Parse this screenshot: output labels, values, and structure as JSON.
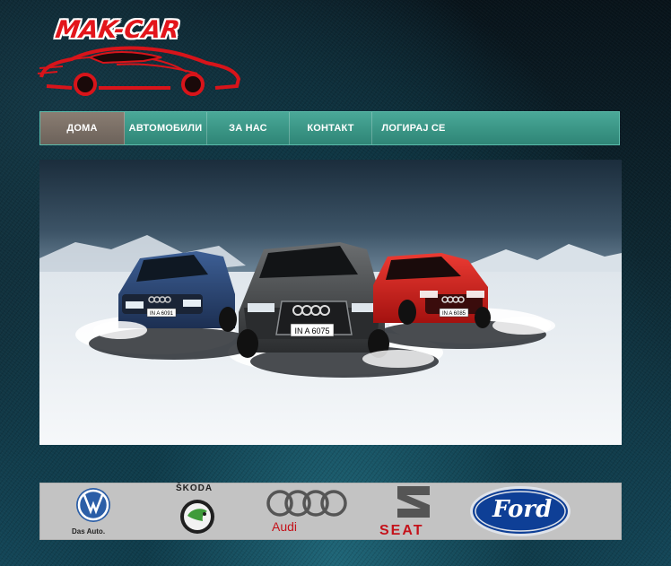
{
  "logo": {
    "text": "MAK-CAR",
    "color": "#e3151b"
  },
  "nav": {
    "items": [
      {
        "label": "ДОМА",
        "active": true
      },
      {
        "label": "АВТОМОБИЛИ"
      },
      {
        "label": "ЗА НАС"
      },
      {
        "label": "КОНТАКТ"
      },
      {
        "label": "ЛОГИРАЈ СЕ"
      }
    ],
    "accent": "#3a9585",
    "active_color": "#7a6e65"
  },
  "hero": {
    "plates": {
      "left": "IN A 6091",
      "center": "IN A 6075",
      "right": "IN A 6085"
    }
  },
  "brands": {
    "vw": {
      "tagline": "Das Auto."
    },
    "skoda": {
      "name": "ŠKODA"
    },
    "audi": {
      "name": "Audi"
    },
    "seat": {
      "name": "SEAT"
    },
    "ford": {
      "name": "Ford"
    }
  }
}
